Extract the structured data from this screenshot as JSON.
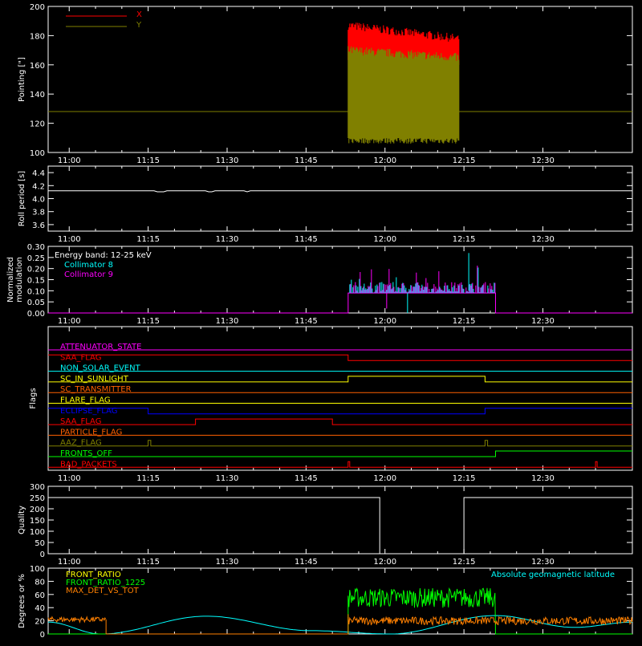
{
  "time_ticks": [
    "11:00",
    "11:15",
    "11:30",
    "11:45",
    "12:00",
    "12:15",
    "12:30"
  ],
  "time_range_minutes": [
    656,
    767
  ],
  "background": "#000000",
  "chart_data": [
    {
      "type": "line",
      "ylabel": "Pointing [\"]",
      "ylim": [
        100,
        200
      ],
      "yticks": [
        "100",
        "120",
        "140",
        "160",
        "180",
        "200"
      ],
      "legend": {
        "placement": "top-left",
        "entries": [
          {
            "name": "X",
            "color": "#ff0000"
          },
          {
            "name": "Y",
            "color": "#808000"
          }
        ]
      },
      "series": [
        {
          "name": "X",
          "color": "#ff0000",
          "x": [
            "11:00",
            "11:53",
            "11:53",
            "12:14",
            "12:14",
            "12:38"
          ],
          "baseline": 128,
          "active": {
            "from": "11:53",
            "to": "12:14",
            "min": 160,
            "max_start": 187,
            "max_end": 178
          }
        },
        {
          "name": "Y",
          "color": "#808000",
          "x": [
            "11:00",
            "11:53",
            "11:53",
            "12:14",
            "12:14",
            "12:38"
          ],
          "baseline": 128,
          "active": {
            "from": "11:53",
            "to": "12:14",
            "min": 108,
            "max_start": 170,
            "max_end": 165
          }
        }
      ]
    },
    {
      "type": "line",
      "ylabel": "Roll period [s]",
      "ylim": [
        3.5,
        4.5
      ],
      "yticks": [
        "3.6",
        "3.8",
        "4.0",
        "4.2",
        "4.4"
      ],
      "series": [
        {
          "name": "",
          "color": "#ffffff",
          "value": 4.12
        }
      ]
    },
    {
      "type": "bar",
      "ylabel": "Normalized modulation",
      "ylim": [
        0,
        0.3
      ],
      "yticks": [
        "0.00",
        "0.05",
        "0.10",
        "0.15",
        "0.20",
        "0.25",
        "0.30"
      ],
      "annotation": "Energy band: 12-25 keV",
      "legend": {
        "placement": "top-left",
        "entries": [
          {
            "name": "Collimator 8",
            "color": "#00ffff"
          },
          {
            "name": "Collimator 9",
            "color": "#ff00ff"
          }
        ]
      },
      "active": {
        "from": "11:53",
        "to": "12:21",
        "floor": 0.09,
        "peak": 0.27
      }
    },
    {
      "type": "line",
      "ylabel": "Flags",
      "flags": [
        {
          "name": "ATTENUATOR_STATE",
          "color": "#ff00ff",
          "state": [
            [
              656,
              0
            ],
            [
              767,
              0
            ]
          ]
        },
        {
          "name": "SAA_FLAG",
          "color": "#ff0000",
          "state": [
            [
              656,
              1
            ],
            [
              713,
              1
            ],
            [
              713,
              0
            ],
            [
              767,
              0
            ]
          ]
        },
        {
          "name": "NON_SOLAR_EVENT",
          "color": "#00ffff",
          "state": [
            [
              656,
              0
            ],
            [
              767,
              0
            ]
          ]
        },
        {
          "name": "SC_IN_SUNLIGHT",
          "color": "#ffff00",
          "state": [
            [
              656,
              0
            ],
            [
              713,
              0
            ],
            [
              713,
              1
            ],
            [
              739,
              1
            ],
            [
              739,
              0
            ],
            [
              767,
              0
            ]
          ]
        },
        {
          "name": "SC_TRANSMITTER",
          "color": "#ff6000",
          "state": [
            [
              656,
              0
            ],
            [
              767,
              0
            ]
          ]
        },
        {
          "name": "FLARE_FLAG",
          "color": "#ffff00",
          "state": [
            [
              656,
              0
            ],
            [
              767,
              0
            ]
          ]
        },
        {
          "name": "ECLIPSE_FLAG",
          "color": "#0000ff",
          "state": [
            [
              656,
              1
            ],
            [
              675,
              1
            ],
            [
              675,
              0
            ],
            [
              739,
              0
            ],
            [
              739,
              1
            ],
            [
              767,
              1
            ]
          ]
        },
        {
          "name": "SAA_FLAG",
          "color": "#ff0000",
          "state": [
            [
              656,
              0
            ],
            [
              684,
              0
            ],
            [
              684,
              1
            ],
            [
              710,
              1
            ],
            [
              710,
              0
            ],
            [
              767,
              0
            ]
          ]
        },
        {
          "name": "PARTICLE_FLAG",
          "color": "#ff6000",
          "state": [
            [
              656,
              0
            ],
            [
              767,
              0
            ]
          ]
        },
        {
          "name": "AAZ_FLAG",
          "color": "#808000",
          "state": [
            [
              656,
              0
            ],
            [
              675,
              0
            ],
            [
              675,
              1
            ],
            [
              675.5,
              1
            ],
            [
              675.5,
              0
            ],
            [
              739,
              0
            ],
            [
              739,
              1
            ],
            [
              739.5,
              1
            ],
            [
              739.5,
              0
            ],
            [
              767,
              0
            ]
          ]
        },
        {
          "name": "FRONTS_OFF",
          "color": "#00ff00",
          "state": [
            [
              656,
              0
            ],
            [
              741,
              0
            ],
            [
              741,
              1
            ],
            [
              767,
              1
            ]
          ]
        },
        {
          "name": "BAD_PACKETS",
          "color": "#ff0000",
          "state": [
            [
              656,
              0
            ],
            [
              713,
              0
            ],
            [
              713,
              1
            ],
            [
              713.3,
              1
            ],
            [
              713.3,
              0
            ],
            [
              760,
              0
            ],
            [
              760,
              1
            ],
            [
              760.3,
              1
            ],
            [
              760.3,
              0
            ],
            [
              767,
              0
            ]
          ]
        }
      ]
    },
    {
      "type": "line",
      "ylabel": "Quality",
      "ylim": [
        0,
        300
      ],
      "yticks": [
        "0",
        "50",
        "100",
        "150",
        "200",
        "250",
        "300"
      ],
      "series": [
        {
          "name": "",
          "color": "#ffffff",
          "x": [
            656,
            719,
            719,
            735,
            735,
            767
          ],
          "y": [
            250,
            250,
            0,
            0,
            250,
            250
          ]
        }
      ]
    },
    {
      "type": "line",
      "ylabel": "Degrees or %",
      "ylim": [
        0,
        100
      ],
      "yticks": [
        "0",
        "20",
        "40",
        "60",
        "80",
        "100"
      ],
      "legend": {
        "placement": "top-left",
        "entries": [
          {
            "name": "FRONT_RATIO",
            "color": "#ffff00"
          },
          {
            "name": "FRONT_RATIO_1225",
            "color": "#00ff00"
          },
          {
            "name": "MAX_DET_VS_TOT",
            "color": "#ff8000"
          }
        ]
      },
      "annotation": "Absolute geomagnetic latitude",
      "annotation_color": "#00ffff",
      "series": [
        {
          "name": "Absolute geomagnetic latitude",
          "color": "#00ffff",
          "x": [
            656,
            666,
            686,
            706,
            721,
            741,
            756,
            767
          ],
          "y": [
            18,
            0,
            27,
            5,
            0,
            28,
            10,
            18
          ]
        },
        {
          "name": "FRONT_RATIO_1225",
          "color": "#00ff00",
          "active": {
            "from": 713,
            "to": 741,
            "mean": 55,
            "spread": 15
          }
        },
        {
          "name": "MAX_DET_VS_TOT",
          "color": "#ff8000",
          "segments": [
            {
              "from": 656,
              "to": 667,
              "mean": 22,
              "spread": 4
            },
            {
              "from": 713,
              "to": 767,
              "mean": 20,
              "spread": 6
            }
          ]
        }
      ]
    }
  ]
}
